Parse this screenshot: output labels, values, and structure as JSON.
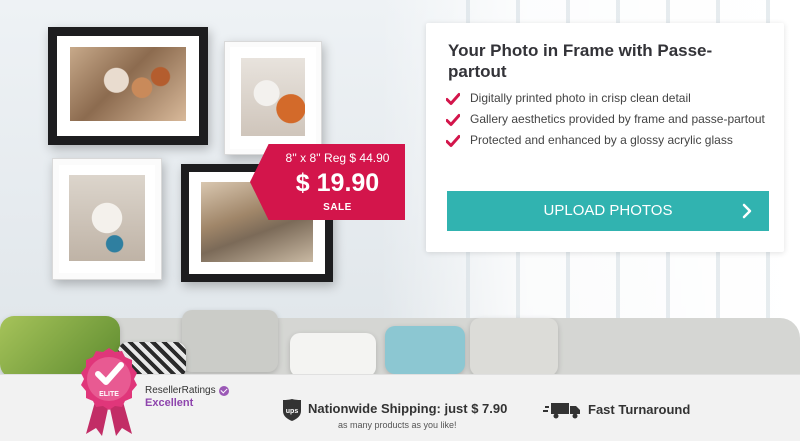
{
  "card": {
    "title": "Your Photo in Frame with Passe-partout",
    "features": [
      "Digitally printed photo in crisp clean detail",
      "Gallery aesthetics provided by frame and passe-partout",
      "Protected and enhanced by a glossy acrylic glass"
    ],
    "upload_label": "UPLOAD PHOTOS"
  },
  "price_tag": {
    "size_reg": "8'' x 8'' Reg $ 44.90",
    "price": "$ 19.90",
    "sale": "SALE"
  },
  "bottom_bar": {
    "badge_label": "ELITE",
    "reseller_name": "ResellerRatings",
    "reseller_score": "Excellent",
    "shipping_title": "Nationwide Shipping: just $ 7.90",
    "shipping_sub": "as many products as you like!",
    "fast_turnaround": "Fast Turnaround"
  },
  "colors": {
    "accent_red": "#d3154b",
    "button_teal": "#31b3b0",
    "badge_pink": "#e0367a",
    "rating_purple": "#8e44ad"
  },
  "icons": [
    "check-icon",
    "chevron-right-icon",
    "elite-badge-icon",
    "verified-icon",
    "ups-icon",
    "truck-icon"
  ]
}
